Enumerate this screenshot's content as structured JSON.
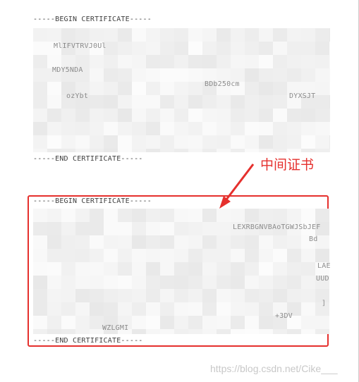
{
  "certificate_1": {
    "begin_label": "-----BEGIN CERTIFICATE-----",
    "end_label": "-----END CERTIFICATE-----",
    "visible_fragments": [
      "MDY5NDA",
      "BDb250cm",
      "DYXSJT",
      "ozYbt",
      "MlIFVTRVJ0Ul"
    ]
  },
  "certificate_2": {
    "begin_label": "-----BEGIN CERTIFICATE-----",
    "end_label": "-----END CERTIFICATE-----",
    "visible_fragments": [
      "LEXRBGNVBAoTGWJSbJEF",
      "Bd",
      "LAE",
      "UUD",
      "]",
      "+3DV",
      "WZLGMI"
    ]
  },
  "annotation": {
    "label": "中间证书",
    "color": "#e5302d"
  },
  "watermark": {
    "text": "https://blog.csdn.net/Cike___"
  }
}
